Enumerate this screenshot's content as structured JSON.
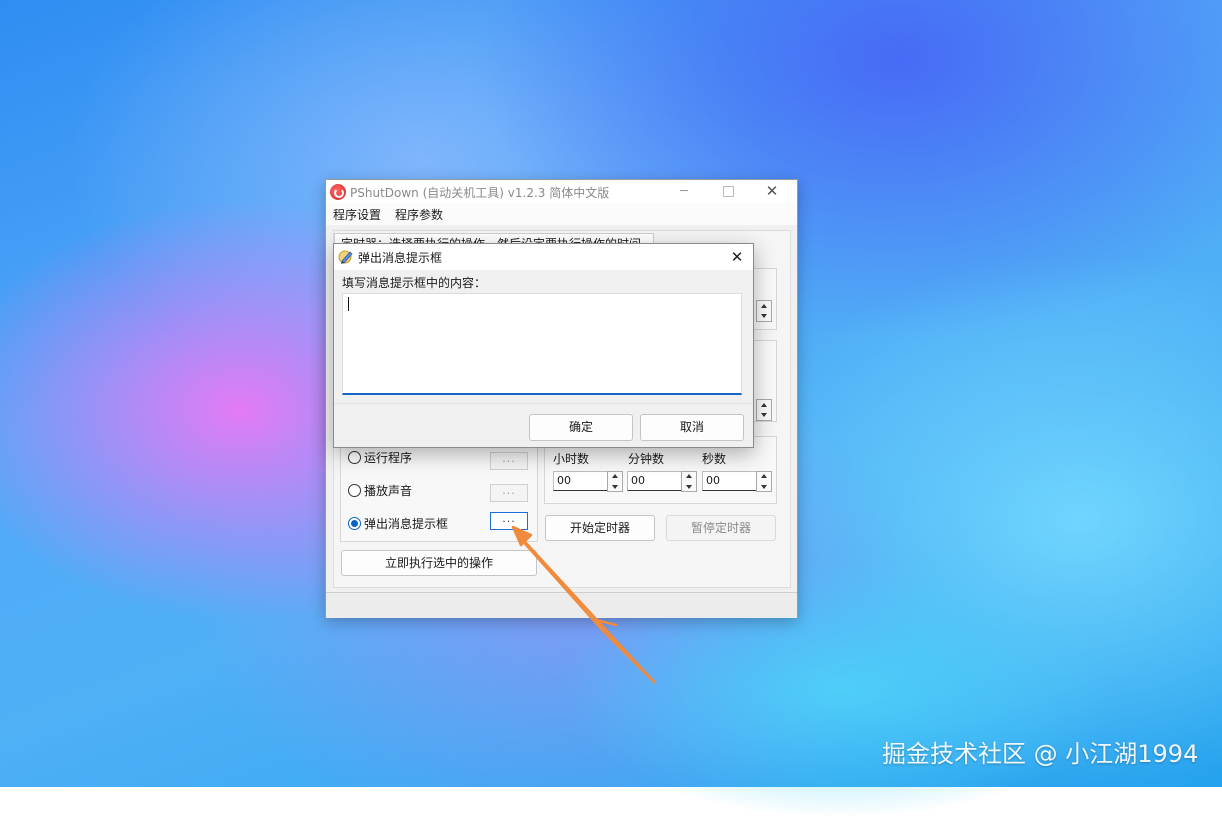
{
  "window": {
    "title": "PShutDown (自动关机工具) v1.2.3 简体中文版",
    "minimize": "─",
    "close": "✕"
  },
  "menu": {
    "items": [
      "程序设置",
      "程序参数"
    ]
  },
  "timer_tab": {
    "label": "定时器：选择要执行的操作，然后设定要执行操作的时间"
  },
  "actions": {
    "run_program": "运行程序",
    "play_sound": "播放声音",
    "popup_message": "弹出消息提示框",
    "selected": "popup_message",
    "dots": "..."
  },
  "timer": {
    "hours_label": "小时数",
    "minutes_label": "分钟数",
    "seconds_label": "秒数",
    "hours_value": "00",
    "minutes_value": "00",
    "seconds_value": "00"
  },
  "buttons": {
    "execute_now": "立即执行选中的操作",
    "start_timer": "开始定时器",
    "pause_timer": "暂停定时器"
  },
  "dialog": {
    "title": "弹出消息提示框",
    "close": "✕",
    "prompt": "填写消息提示框中的内容：",
    "content": "",
    "ok": "确定",
    "cancel": "取消"
  },
  "watermark": "掘金技术社区 @ 小江湖1994",
  "colors": {
    "accent": "#1a64c8",
    "arrow": "#f08a3c"
  }
}
